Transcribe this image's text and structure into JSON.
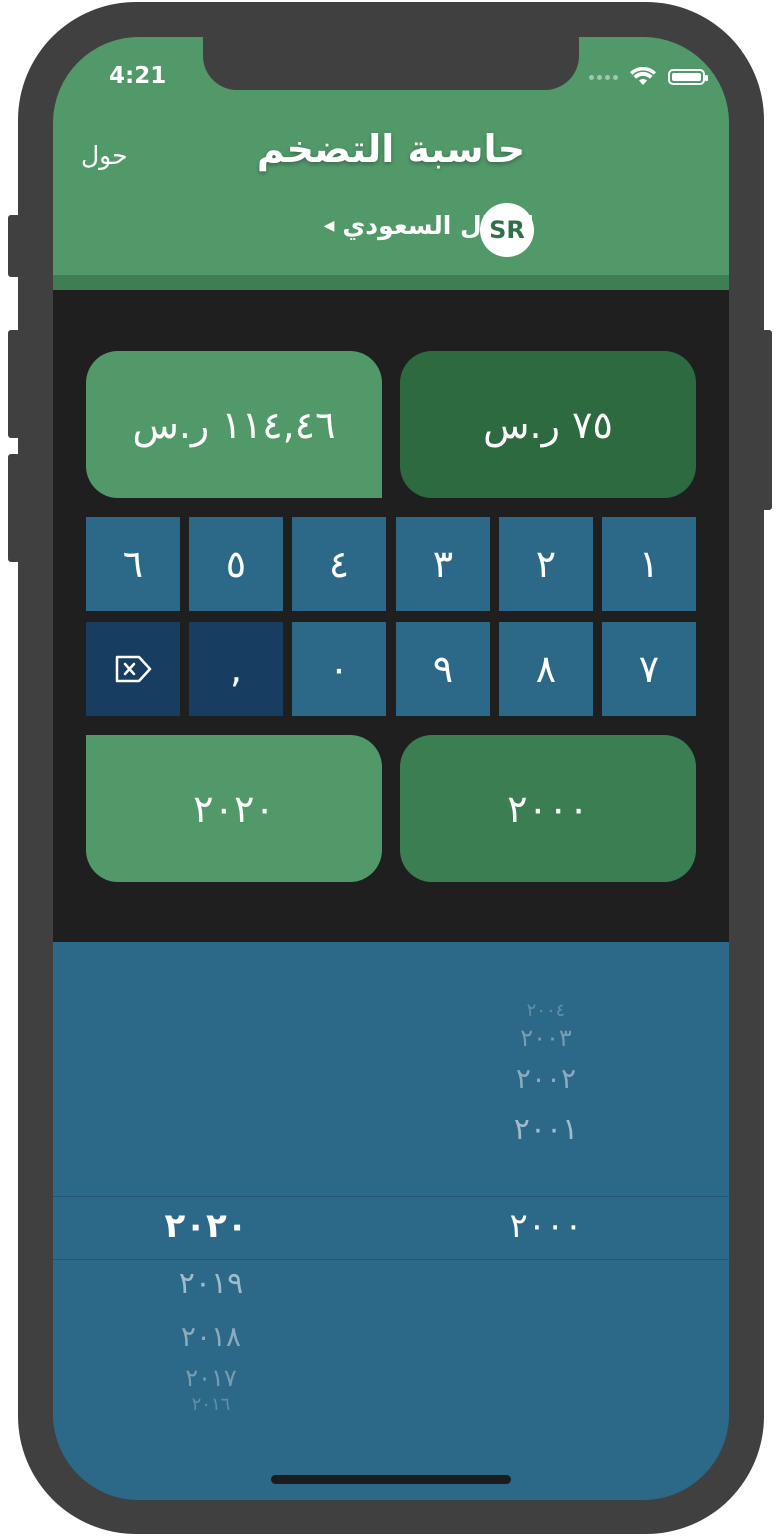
{
  "status": {
    "time": "4:21"
  },
  "header": {
    "title": "حاسبة التضخم",
    "about": "حول",
    "currency_name": "الريال السعودي",
    "currency_code": "SR"
  },
  "amounts": {
    "result": "١١٤,٤٦ ر.س",
    "input": "٧٥ ر.س"
  },
  "keypad": {
    "row1": [
      "٦",
      "٥",
      "٤",
      "٣",
      "٢",
      "١"
    ],
    "row2_decimal": ",",
    "row2": [
      "٠",
      "٩",
      "٨",
      "٧"
    ]
  },
  "years": {
    "to": "٢٠٢٠",
    "from": "٢٠٠٠"
  },
  "picker": {
    "from_above": [
      "٢٠٠٤",
      "٢٠٠٣",
      "٢٠٠٢",
      "٢٠٠١"
    ],
    "from_selected": "٢٠٠٠",
    "to_selected": "٢٠٢٠",
    "to_below": [
      "٢٠١٩",
      "٢٠١٨",
      "٢٠١٧",
      "٢٠١٦"
    ]
  },
  "colors": {
    "header_green": "#529969",
    "input_green": "#2e6a3f",
    "key_blue": "#2c6888",
    "key_dark": "#173e60",
    "panel": "#1f1f1f"
  }
}
